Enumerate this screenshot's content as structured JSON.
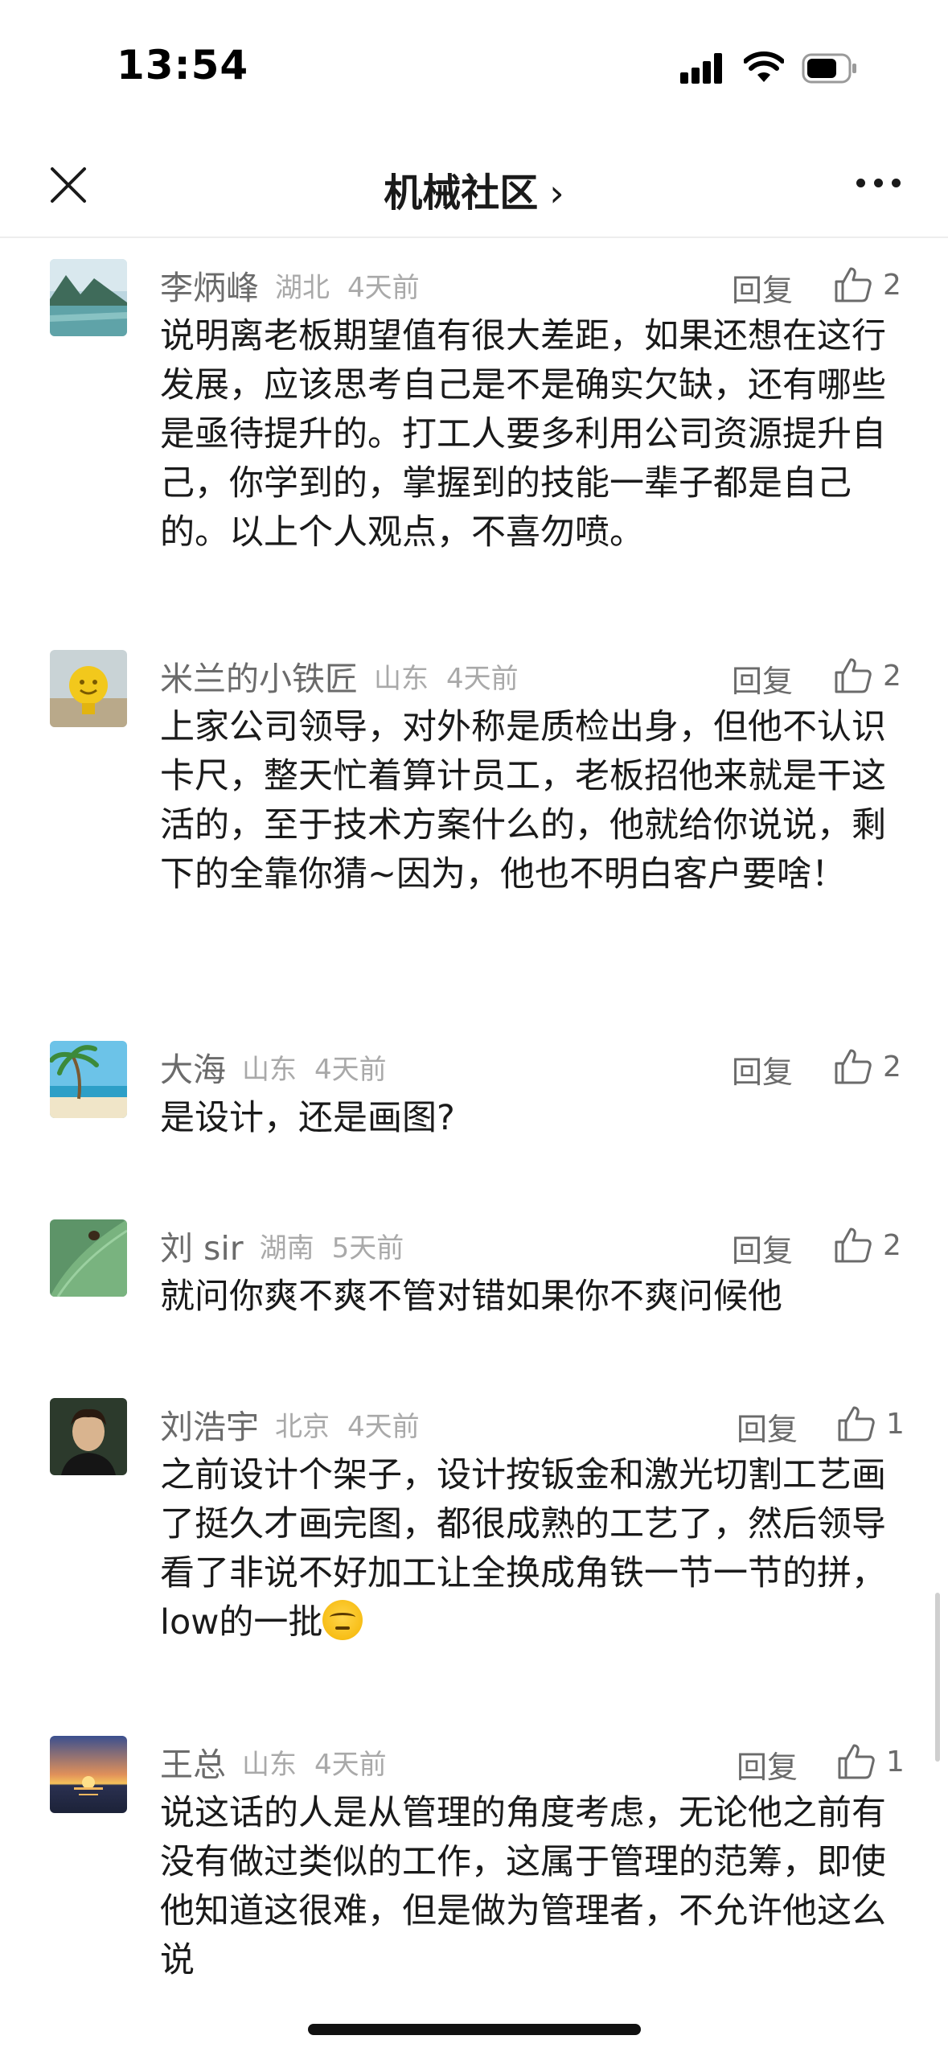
{
  "status_bar": {
    "time": "13:54"
  },
  "nav": {
    "title": "机械社区",
    "chevron": "›"
  },
  "reply_label": "回复",
  "comments": [
    {
      "name": "李炳峰",
      "location": "湖北",
      "time": "4天前",
      "likes": "2",
      "body": "说明离老板期望值有很大差距，如果还想在这行发展，应该思考自己是不是确实欠缺，还有哪些是亟待提升的。打工人要多利用公司资源提升自己，你学到的，掌握到的技能一辈子都是自己的。以上个人观点，不喜勿喷。",
      "avatar": "lake-landscape"
    },
    {
      "name": "米兰的小铁匠",
      "location": "山东",
      "time": "4天前",
      "likes": "2",
      "body": "上家公司领导，对外称是质检出身，但他不认识卡尺，整天忙着算计员工，老板招他来就是干这活的，至于技术方案什么的，他就给你说说，剩下的全靠你猜~因为，他也不明白客户要啥！",
      "avatar": "yellow-smiley"
    },
    {
      "name": "大海",
      "location": "山东",
      "time": "4天前",
      "likes": "2",
      "body": "是设计，还是画图?",
      "avatar": "beach-palm"
    },
    {
      "name": "刘 sir",
      "location": "湖南",
      "time": "5天前",
      "likes": "2",
      "body": "就问你爽不爽不管对错如果你不爽问候他",
      "avatar": "green-leaf-ladybug"
    },
    {
      "name": "刘浩宇",
      "location": "北京",
      "time": "4天前",
      "likes": "1",
      "body": "之前设计个架子，设计按钣金和激光切割工艺画了挺久才画完图，都很成熟的工艺了，然后领导看了非说不好加工让全换成角铁一节一节的拼，low的一批",
      "avatar": "portrait-painting"
    },
    {
      "name": "王总",
      "location": "山东",
      "time": "4天前",
      "likes": "1",
      "body": "说这话的人是从管理的角度考虑，无论他之前有没有做过类似的工作，这属于管理的范筹，即使他知道这很难，但是做为管理者，不允许他这么说",
      "avatar": "sunset"
    }
  ]
}
